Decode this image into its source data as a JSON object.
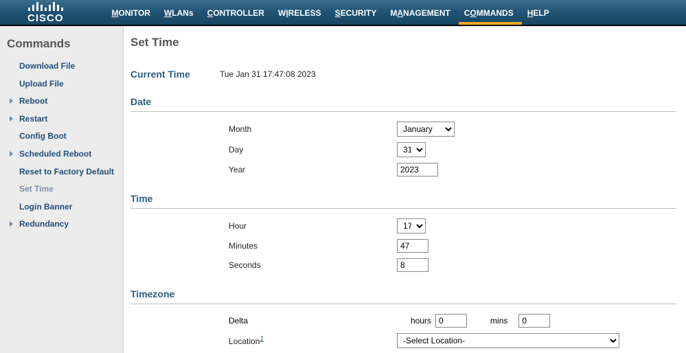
{
  "nav": {
    "items": [
      {
        "label": "MONITOR",
        "accesskey": "M"
      },
      {
        "label": "WLANs",
        "accesskey": "W"
      },
      {
        "label": "CONTROLLER",
        "accesskey": "C"
      },
      {
        "label": "WIRELESS",
        "accesskey": "W"
      },
      {
        "label": "SECURITY",
        "accesskey": "S"
      },
      {
        "label": "MANAGEMENT",
        "accesskey": "M"
      },
      {
        "label": "COMMANDS",
        "accesskey": "C",
        "active": true
      },
      {
        "label": "HELP",
        "accesskey": "H"
      }
    ]
  },
  "sidebar": {
    "title": "Commands",
    "items": [
      {
        "label": "Download File"
      },
      {
        "label": "Upload File"
      },
      {
        "label": "Reboot",
        "arrow": true
      },
      {
        "label": "Restart",
        "arrow": true
      },
      {
        "label": "Config Boot"
      },
      {
        "label": "Scheduled Reboot",
        "arrow": true
      },
      {
        "label": "Reset to Factory Default"
      },
      {
        "label": "Set Time",
        "active": true
      },
      {
        "label": "Login Banner"
      },
      {
        "label": "Redundancy",
        "arrow": true
      }
    ]
  },
  "page": {
    "title": "Set Time",
    "current_time_label": "Current Time",
    "current_time_value": "Tue Jan 31 17:47:08 2023",
    "sections": {
      "date": {
        "heading": "Date",
        "month_label": "Month",
        "month_value": "January",
        "day_label": "Day",
        "day_value": "31",
        "year_label": "Year",
        "year_value": "2023"
      },
      "time": {
        "heading": "Time",
        "hour_label": "Hour",
        "hour_value": "17",
        "minutes_label": "Minutes",
        "minutes_value": "47",
        "seconds_label": "Seconds",
        "seconds_value": "8"
      },
      "timezone": {
        "heading": "Timezone",
        "delta_label": "Delta",
        "delta_hours_label": "hours",
        "delta_hours_value": "0",
        "delta_mins_label": "mins",
        "delta_mins_value": "0",
        "location_label": "Location",
        "location_footnote": "1",
        "location_value": "-Select Location-"
      }
    }
  }
}
